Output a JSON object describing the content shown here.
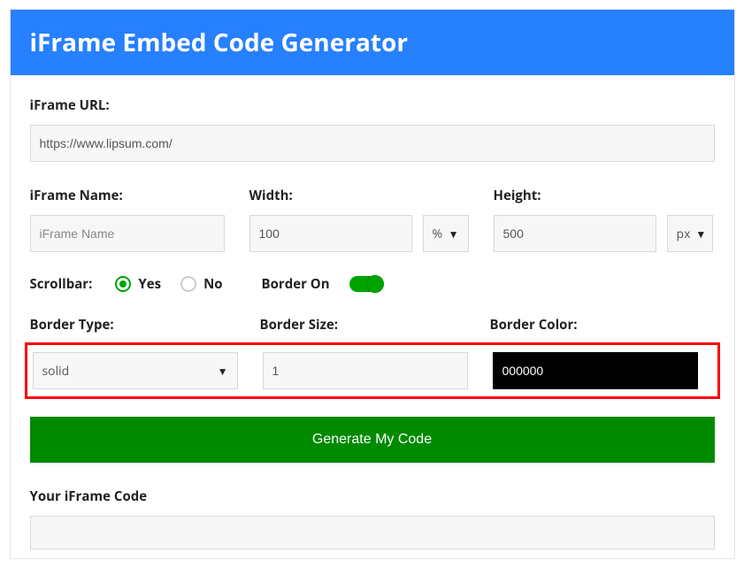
{
  "header": {
    "title": "iFrame Embed Code Generator"
  },
  "url_field": {
    "label": "iFrame URL:",
    "value": "https://www.lipsum.com/"
  },
  "name_field": {
    "label": "iFrame Name:",
    "placeholder": "iFrame Name",
    "value": ""
  },
  "width_field": {
    "label": "Width:",
    "value": "100",
    "unit": "%"
  },
  "height_field": {
    "label": "Height:",
    "value": "500",
    "unit": "px"
  },
  "scrollbar": {
    "label": "Scrollbar:",
    "yes": "Yes",
    "no": "No",
    "selected": "yes"
  },
  "border_on": {
    "label": "Border On",
    "enabled": true
  },
  "border_type": {
    "label": "Border Type:",
    "value": "solid"
  },
  "border_size": {
    "label": "Border Size:",
    "value": "1"
  },
  "border_color": {
    "label": "Border Color:",
    "value": "000000"
  },
  "generate_button": {
    "label": "Generate My Code"
  },
  "output": {
    "label": "Your iFrame Code"
  }
}
